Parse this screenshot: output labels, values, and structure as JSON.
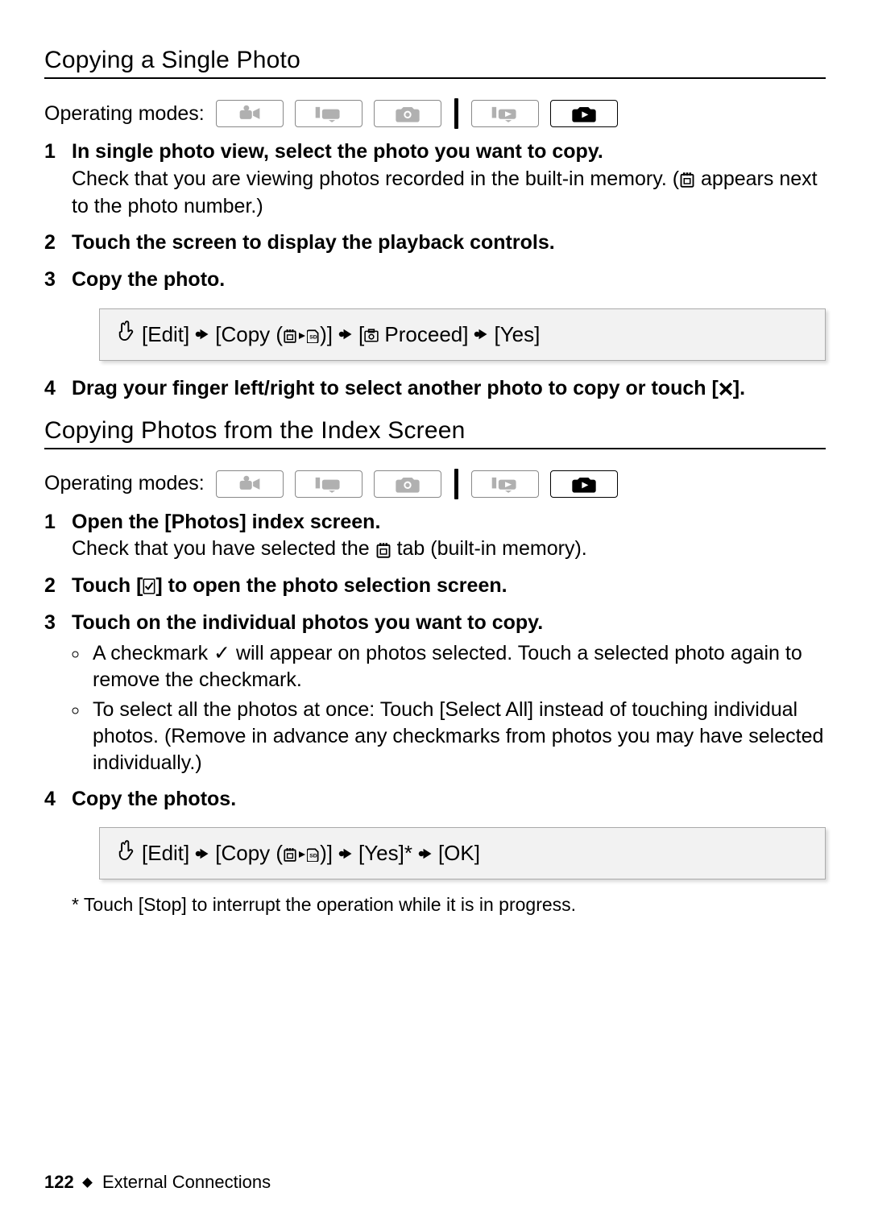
{
  "footer": {
    "page": "122",
    "section": "External Connections"
  },
  "opmodes_label": "Operating modes:",
  "section1": {
    "title": "Copying a Single Photo",
    "steps": {
      "s1_title": "In single photo view, select the photo you want to copy.",
      "s1_body_a": "Check that you are viewing photos recorded in the built-in memory. (",
      "s1_body_b": " appears next to the photo number.)",
      "s2_title": "Touch the screen to display the playback controls.",
      "s3_title": "Copy the photo.",
      "s4_title_a": "Drag your finger left/right to select another photo to copy or touch [",
      "s4_title_b": "]."
    },
    "seq": {
      "edit": "[Edit]",
      "copy_a": "[Copy (",
      "copy_b": ")]",
      "proceed_a": "[",
      "proceed_b": " Proceed]",
      "yes": "[Yes]"
    }
  },
  "section2": {
    "title": "Copying Photos from the Index Screen",
    "steps": {
      "s1_title": "Open the [Photos] index screen.",
      "s1_body_a": "Check that you have selected the ",
      "s1_body_b": " tab (built-in memory).",
      "s2_title_a": "Touch [",
      "s2_title_b": "] to open the photo selection screen.",
      "s3_title": "Touch on the individual photos you want to copy.",
      "s3_b1": "A checkmark ✓ will appear on photos selected. Touch a selected photo again to remove the checkmark.",
      "s3_b2": "To select all the photos at once: Touch [Select All] instead of touching individual photos. (Remove in advance any checkmarks from photos you may have selected individually.)",
      "s4_title": "Copy the photos."
    },
    "seq": {
      "edit": "[Edit]",
      "copy_a": "[Copy (",
      "copy_b": ")]",
      "yes_star": "[Yes]*",
      "ok": "[OK]"
    },
    "footnote": "* Touch [Stop] to interrupt the operation while it is in progress."
  }
}
